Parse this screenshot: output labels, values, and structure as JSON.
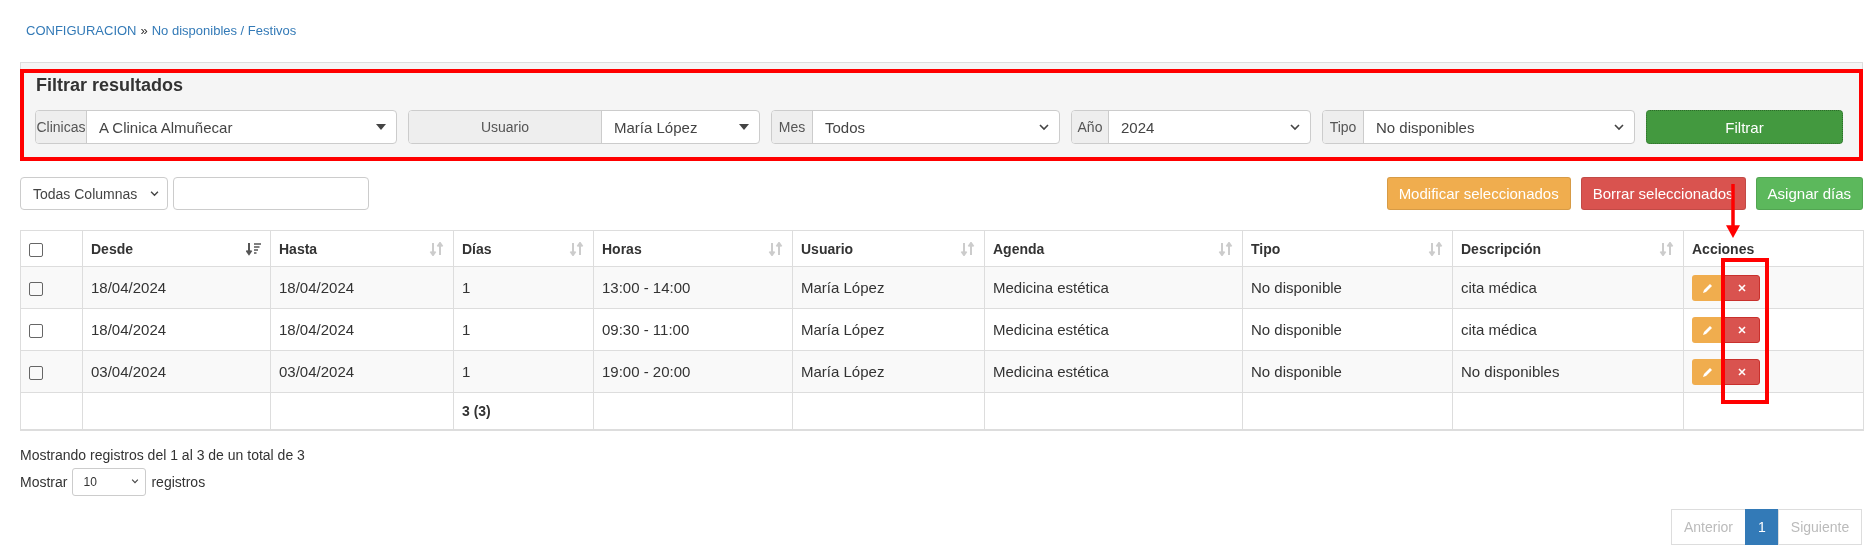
{
  "breadcrumb": [
    {
      "text": "CONFIGURACION",
      "kind": "link"
    },
    {
      "text": "»",
      "kind": "separator"
    },
    {
      "text": "No disponibles / Festivos",
      "kind": "link"
    }
  ],
  "filter": {
    "title": "Filtrar resultados",
    "fields": [
      {
        "label": "Clinicas",
        "value": "A Clinica Almuñecar",
        "kind": "dropdown"
      },
      {
        "label": "Usuario",
        "value": "María López",
        "kind": "dropdown"
      },
      {
        "label": "Mes",
        "value": "Todos",
        "kind": "select"
      },
      {
        "label": "Año",
        "value": "2024",
        "kind": "select"
      },
      {
        "label": "Tipo",
        "value": "No disponibles",
        "kind": "select"
      }
    ],
    "button": "Filtrar"
  },
  "column_select": "Todas Columnas",
  "actions": [
    {
      "label": "Modificar seleccionados",
      "color": "#f0ad4e"
    },
    {
      "label": "Borrar seleccionados",
      "color": "#d9534f"
    },
    {
      "label": "Asignar días",
      "color": "#5cb85c"
    }
  ],
  "table": {
    "all_checked": false,
    "columns": [
      {
        "label": "Desde",
        "sortable": true,
        "sorted": true
      },
      {
        "label": "Hasta",
        "sortable": true,
        "sorted": false
      },
      {
        "label": "Días",
        "sortable": true,
        "sorted": false,
        "total": "3 (3)"
      },
      {
        "label": "Horas",
        "sortable": true,
        "sorted": false
      },
      {
        "label": "Usuario",
        "sortable": true,
        "sorted": false
      },
      {
        "label": "Agenda",
        "sortable": true,
        "sorted": false
      },
      {
        "label": "Tipo",
        "sortable": true,
        "sorted": false
      },
      {
        "label": "Descripción",
        "sortable": true,
        "sorted": false
      },
      {
        "label": "Acciones",
        "sortable": false
      }
    ],
    "rows": [
      {
        "checked": false,
        "cells": [
          "18/04/2024",
          "18/04/2024",
          "1",
          "13:00 - 14:00",
          "María López",
          "Medicina estética",
          "No disponible",
          "cita médica"
        ]
      },
      {
        "checked": false,
        "cells": [
          "18/04/2024",
          "18/04/2024",
          "1",
          "09:30 - 11:00",
          "María López",
          "Medicina estética",
          "No disponible",
          "cita médica"
        ]
      },
      {
        "checked": false,
        "cells": [
          "03/04/2024",
          "03/04/2024",
          "1",
          "19:00 - 20:00",
          "María López",
          "Medicina estética",
          "No disponible",
          "No disponibles"
        ]
      }
    ]
  },
  "info": "Mostrando registros del 1 al 3 de un total de 3",
  "length": {
    "before": "Mostrar",
    "value": "10",
    "after": "registros"
  },
  "pagination": [
    {
      "label": "Anterior",
      "selected": false,
      "disabled": true
    },
    {
      "label": "1",
      "selected": true,
      "disabled": false
    },
    {
      "label": "Siguiente",
      "selected": false,
      "disabled": true
    }
  ]
}
